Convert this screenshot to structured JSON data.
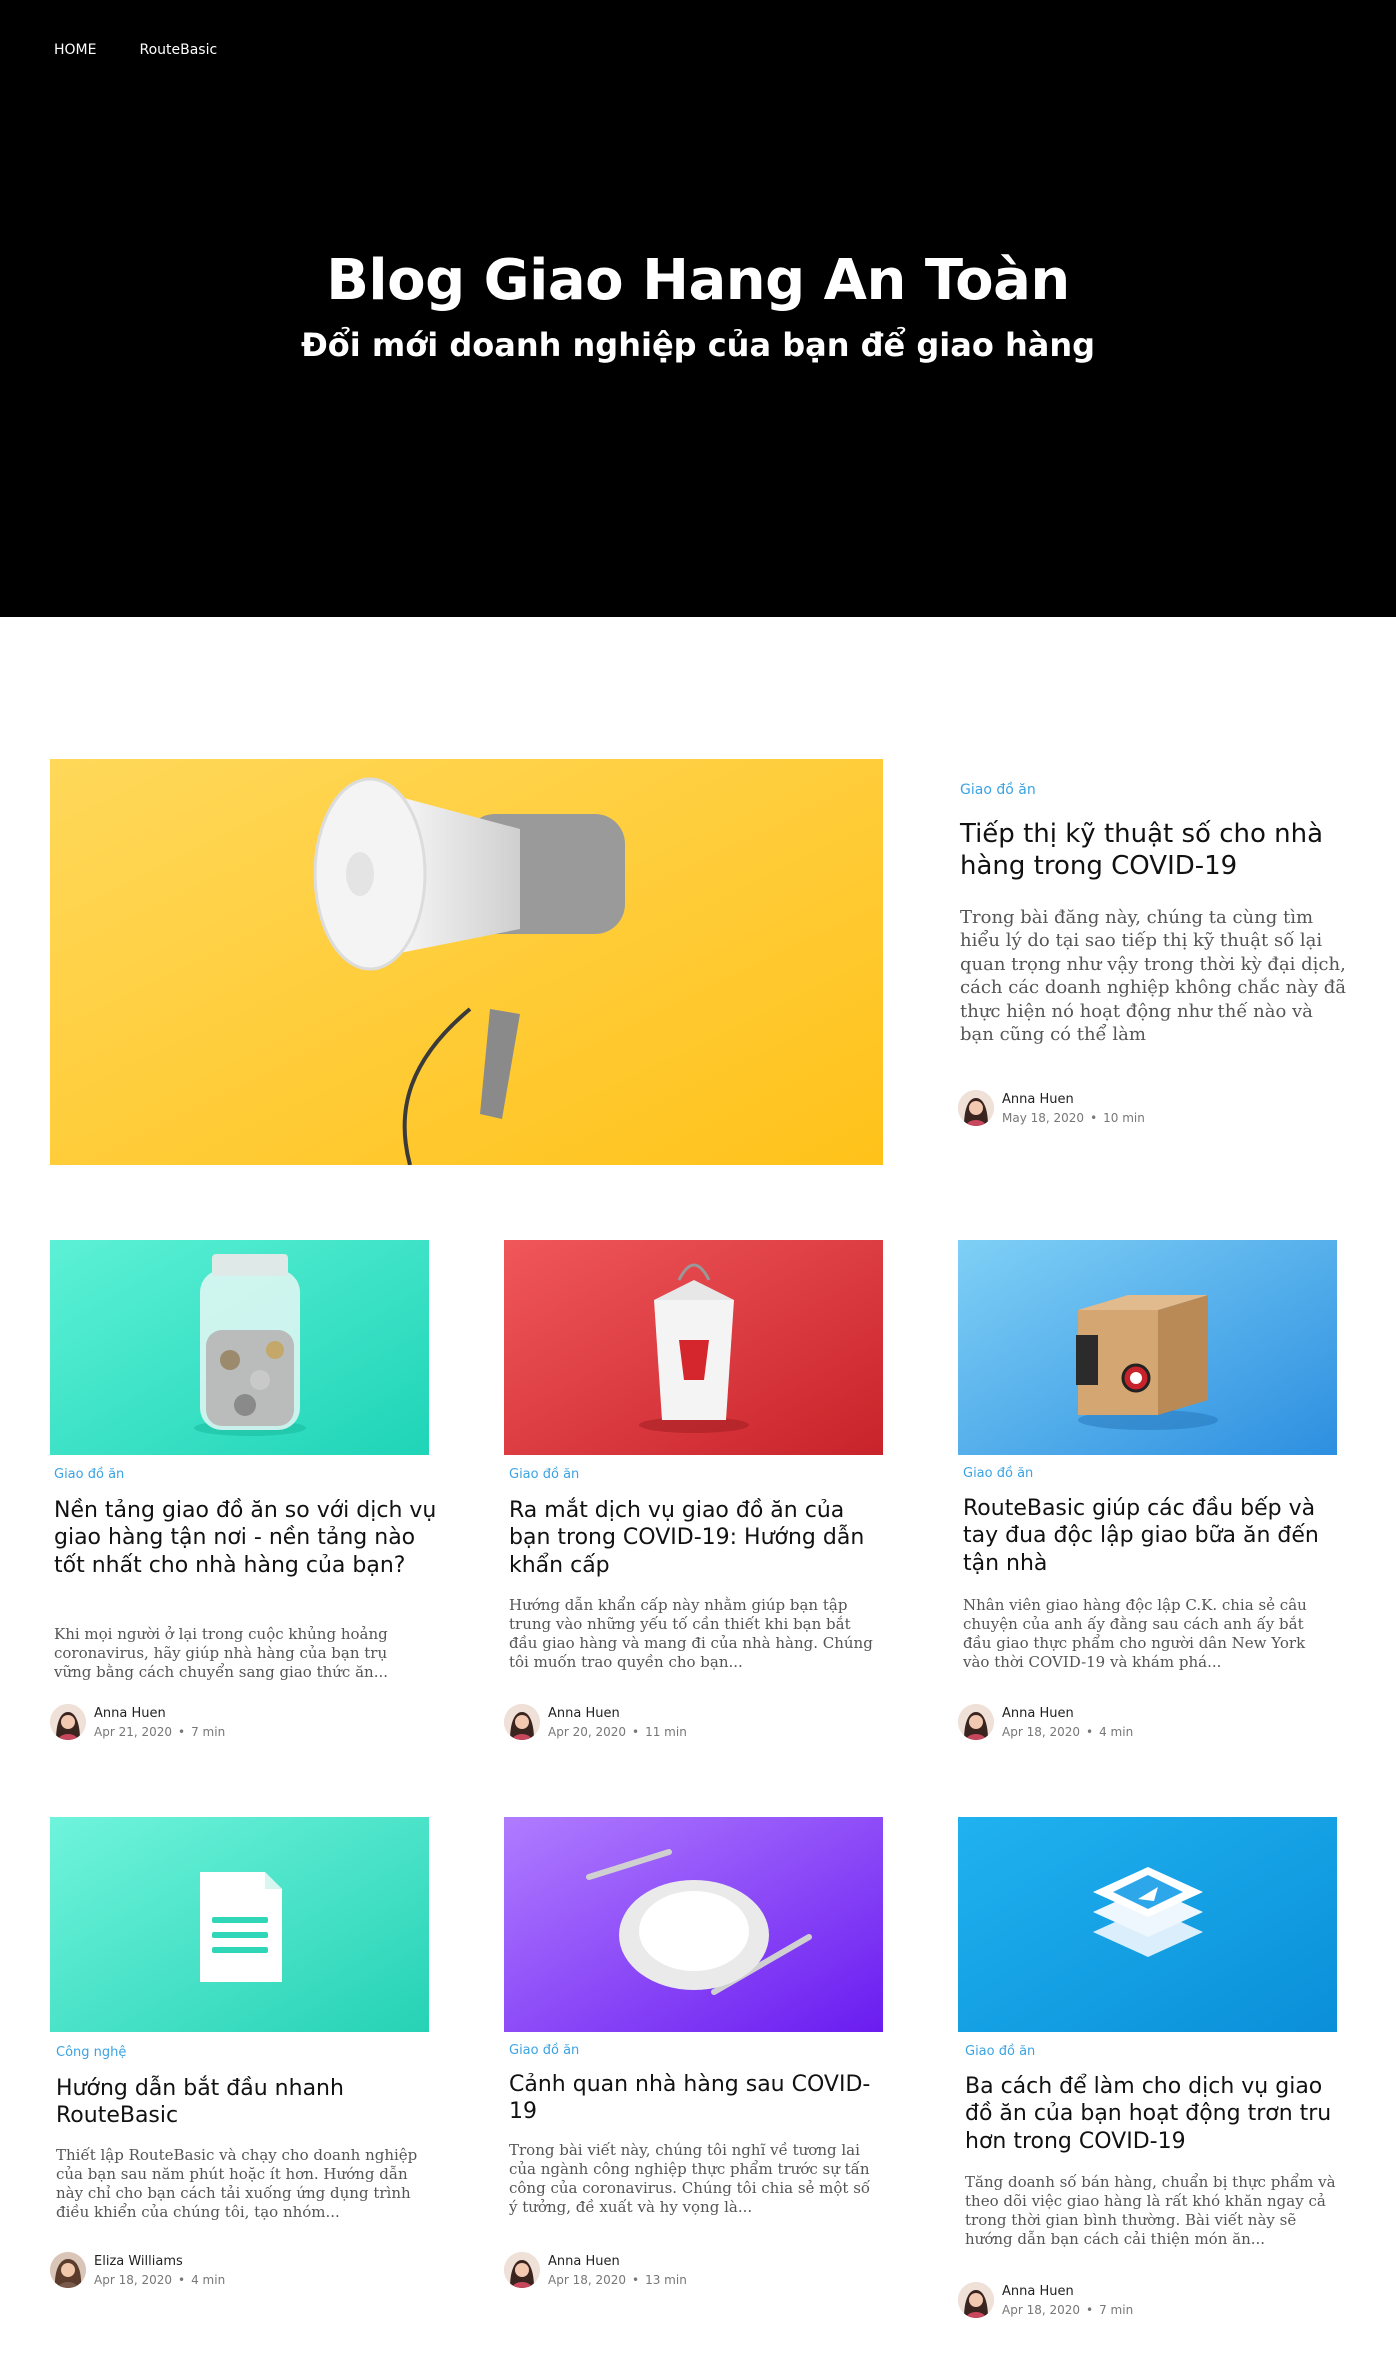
{
  "nav": {
    "home": "HOME",
    "brand": "RouteBasic"
  },
  "hero": {
    "title": "Blog Giao Hang An Toàn",
    "subtitle": "Đổi mới doanh nghiệp của bạn để giao hàng"
  },
  "featured": {
    "category": "Giao đồ ăn",
    "title": "Tiếp thị kỹ thuật số cho nhà hàng trong COVID-19",
    "excerpt": "Trong bài đăng này, chúng ta cùng tìm hiểu lý do tại sao tiếp thị kỹ thuật số lại quan trọng như vậy trong thời kỳ đại dịch, cách các doanh nghiệp không chắc này đã thực hiện nó hoạt động như thế nào và bạn cũng có thể làm",
    "author": "Anna Huen",
    "date": "May 18, 2020",
    "read": "10 min"
  },
  "posts": [
    {
      "category": "Giao đồ ăn",
      "title": "Nền tảng giao đồ ăn so với dịch vụ giao hàng tận nơi - nền tảng nào tốt nhất cho nhà hàng của bạn?",
      "excerpt": "Khi mọi người ở lại trong cuộc khủng hoảng coronavirus, hãy giúp nhà hàng của bạn trụ vững bằng cách chuyển sang giao thức ăn...",
      "author": "Anna Huen",
      "date": "Apr 21, 2020",
      "read": "7 min"
    },
    {
      "category": "Giao đồ ăn",
      "title": "Ra mắt dịch vụ giao đồ ăn của bạn trong COVID-19: Hướng dẫn khẩn cấp",
      "excerpt": "Hướng dẫn khẩn cấp này nhằm giúp bạn tập trung vào những yếu tố cần thiết khi bạn bắt đầu giao hàng và mang đi của nhà hàng. Chúng tôi muốn trao quyền cho bạn...",
      "author": "Anna Huen",
      "date": "Apr 20, 2020",
      "read": "11 min"
    },
    {
      "category": "Giao đồ ăn",
      "title": "RouteBasic giúp các đầu bếp và tay đua độc lập giao bữa ăn đến tận nhà",
      "excerpt": "Nhân viên giao hàng độc lập C.K. chia sẻ câu chuyện của anh ấy đằng sau cách anh ấy bắt đầu giao thực phẩm cho người dân New York vào thời COVID-19 và khám phá...",
      "author": "Anna Huen",
      "date": "Apr 18, 2020",
      "read": "4 min"
    },
    {
      "category": "Công nghệ",
      "title": "Hướng dẫn bắt đầu nhanh RouteBasic",
      "excerpt": "Thiết lập RouteBasic và chạy cho doanh nghiệp của bạn sau năm phút hoặc ít hơn. Hướng dẫn này chỉ cho bạn cách tải xuống ứng dụng trình điều khiển của chúng tôi, tạo nhóm...",
      "author": "Eliza Williams",
      "date": "Apr 18, 2020",
      "read": "4 min"
    },
    {
      "category": "Giao đồ ăn",
      "title": "Cảnh quan nhà hàng sau COVID-19",
      "excerpt": "Trong bài viết này, chúng tôi nghĩ về tương lai của ngành công nghiệp thực phẩm trước sự tấn công của coronavirus. Chúng tôi chia sẻ một số ý tưởng, đề xuất và hy vọng là...",
      "author": "Anna Huen",
      "date": "Apr 18, 2020",
      "read": "13 min"
    },
    {
      "category": "Giao đồ ăn",
      "title": "Ba cách để làm cho dịch vụ giao đồ ăn của bạn hoạt động trơn tru hơn trong COVID-19",
      "excerpt": "Tăng doanh số bán hàng, chuẩn bị thực phẩm và theo dõi việc giao hàng là rất khó khăn ngay cả trong thời gian bình thường. Bài viết này sẽ hướng dẫn bạn cách cải thiện món ăn...",
      "author": "Anna Huen",
      "date": "Apr 18, 2020",
      "read": "7 min"
    }
  ]
}
